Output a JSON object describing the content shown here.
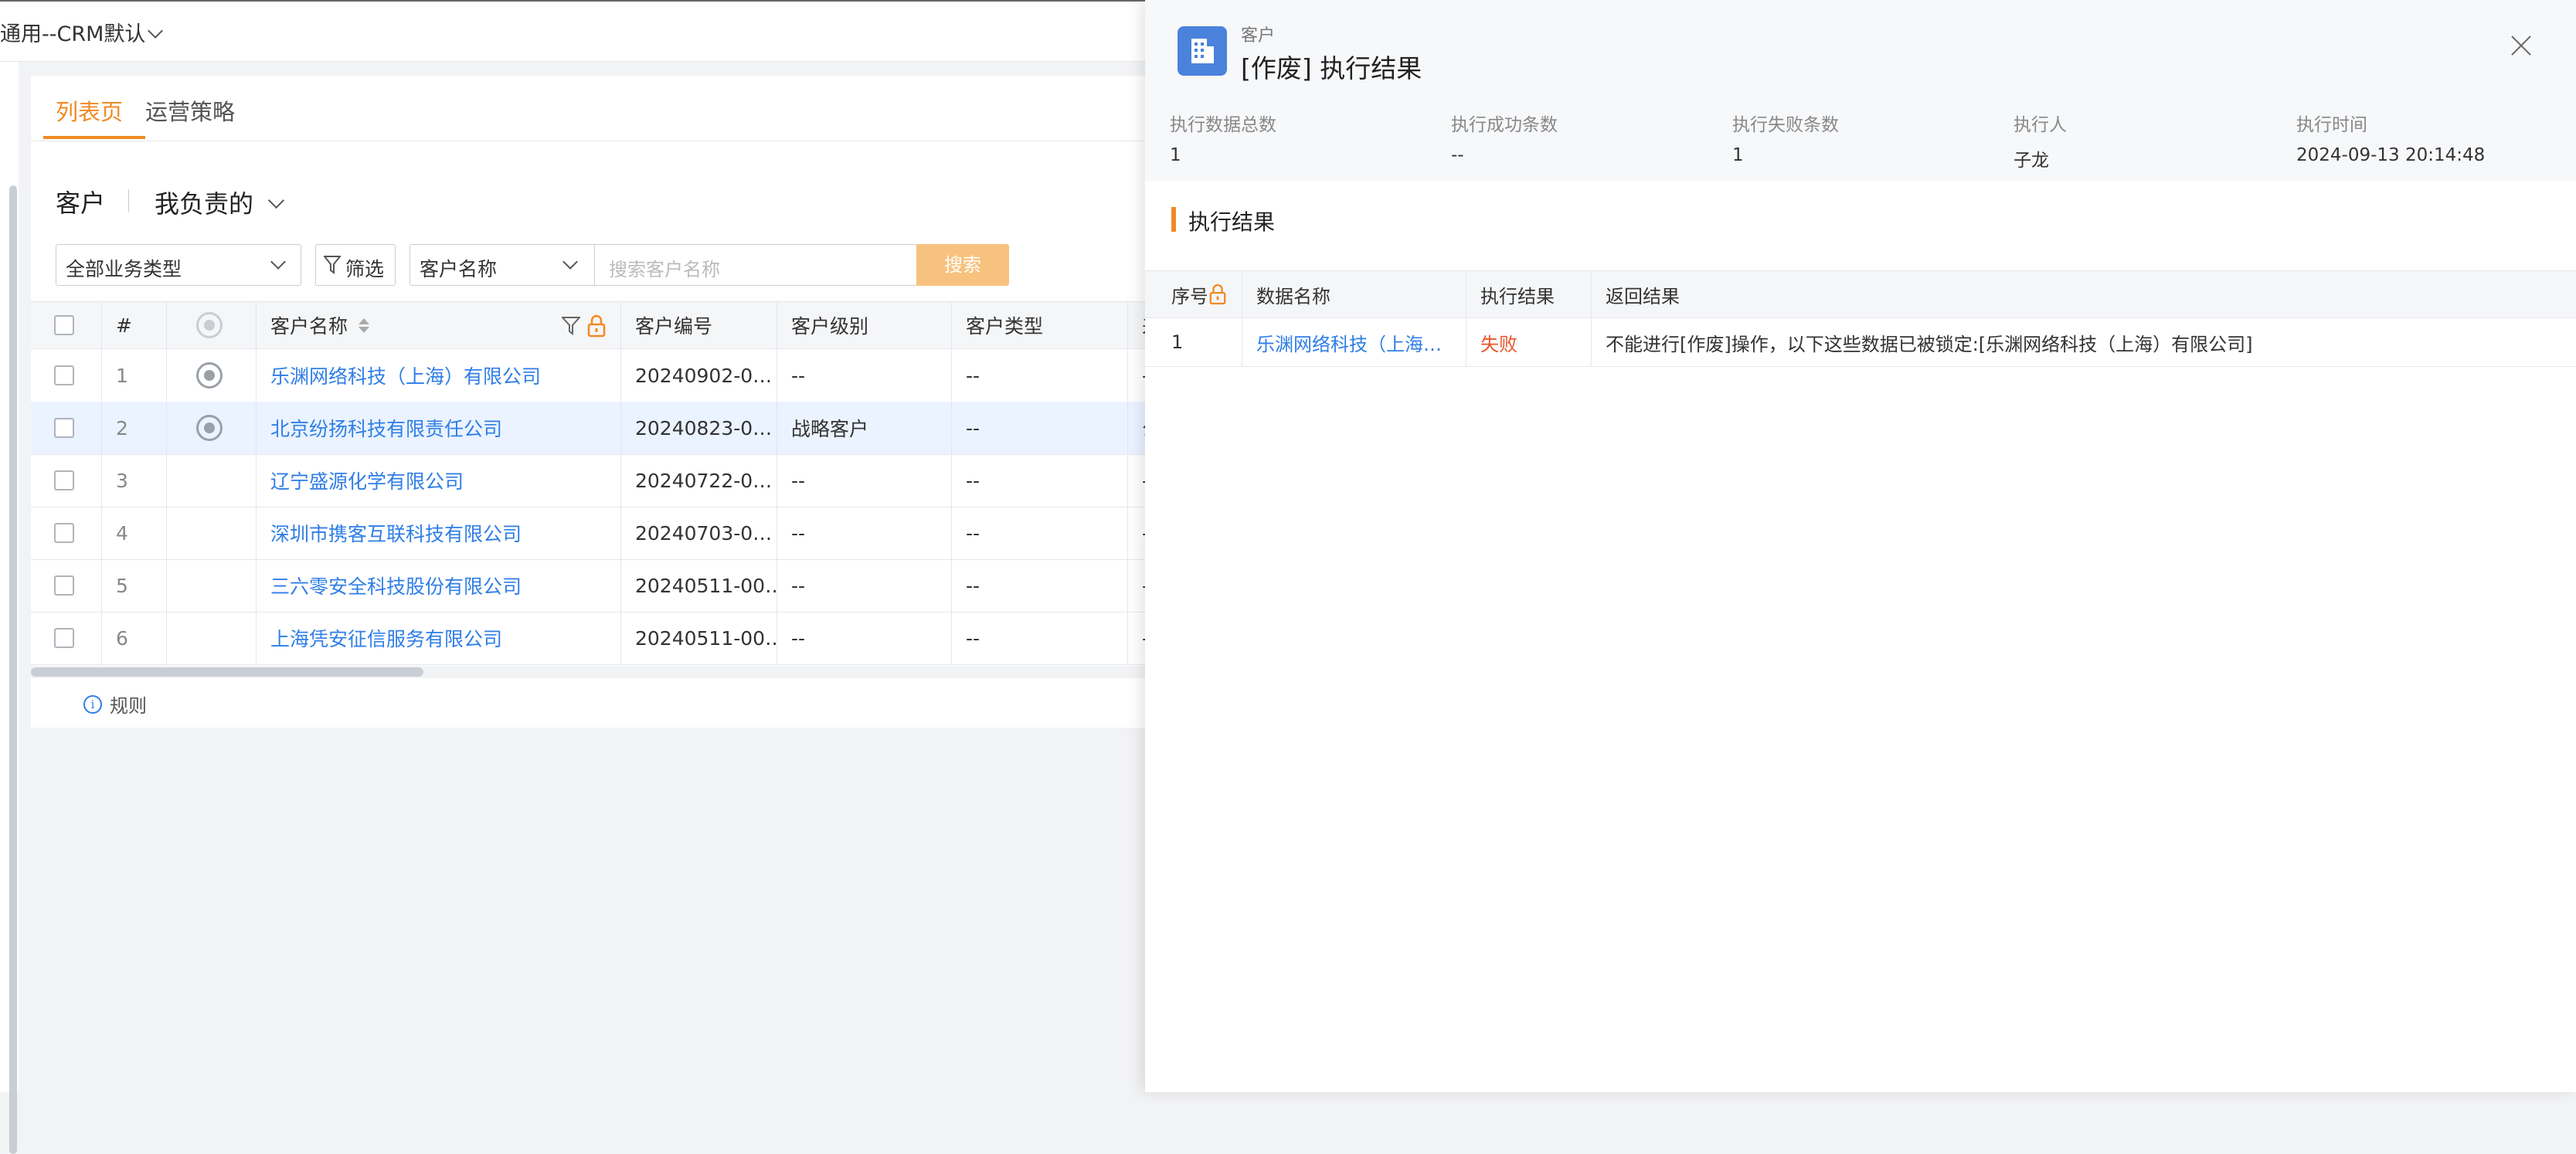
{
  "app": {
    "title": "通用--CRM默认"
  },
  "tabs": [
    {
      "label": "列表页",
      "active": true
    },
    {
      "label": "运营策略",
      "active": false
    }
  ],
  "list": {
    "title": "客户",
    "scope": "我负责的"
  },
  "filters": {
    "biz_type": "全部业务类型",
    "filter_btn": "筛选",
    "field_select": "客户名称",
    "search_placeholder": "搜索客户名称",
    "search_btn": "搜索"
  },
  "table": {
    "headers": {
      "idx": "#",
      "name": "客户名称",
      "code": "客户编号",
      "level": "客户级别",
      "type": "客户类型",
      "extra": "来"
    },
    "rows": [
      {
        "idx": "1",
        "name": "乐渊网络科技（上海）有限公司",
        "code": "20240902-0…",
        "level": "--",
        "type": "--",
        "extra": "--",
        "target": true,
        "selected": false
      },
      {
        "idx": "2",
        "name": "北京纷扬科技有限责任公司",
        "code": "20240823-0…",
        "level": "战略客户",
        "type": "--",
        "extra": "公",
        "target": true,
        "selected": true
      },
      {
        "idx": "3",
        "name": "辽宁盛源化学有限公司",
        "code": "20240722-0…",
        "level": "--",
        "type": "--",
        "extra": "--",
        "target": false,
        "selected": false
      },
      {
        "idx": "4",
        "name": "深圳市携客互联科技有限公司",
        "code": "20240703-0…",
        "level": "--",
        "type": "--",
        "extra": "--",
        "target": false,
        "selected": false
      },
      {
        "idx": "5",
        "name": "三六零安全科技股份有限公司",
        "code": "20240511-00…",
        "level": "--",
        "type": "--",
        "extra": "--",
        "target": false,
        "selected": false
      },
      {
        "idx": "6",
        "name": "上海凭安征信服务有限公司",
        "code": "20240511-00…",
        "level": "--",
        "type": "--",
        "extra": "--",
        "target": false,
        "selected": false
      }
    ]
  },
  "rules_label": "规则",
  "drawer": {
    "object_type": "客户",
    "title": "[作废] 执行结果",
    "stats": [
      {
        "label": "执行数据总数",
        "value": "1"
      },
      {
        "label": "执行成功条数",
        "value": "--"
      },
      {
        "label": "执行失败条数",
        "value": "1"
      },
      {
        "label": "执行人",
        "value": "子龙"
      },
      {
        "label": "执行时间",
        "value": "2024-09-13 20:14:48"
      }
    ],
    "section_title": "执行结果",
    "result_headers": {
      "seq": "序号",
      "name": "数据名称",
      "result": "执行结果",
      "return": "返回结果"
    },
    "results": [
      {
        "seq": "1",
        "name": "乐渊网络科技（上海…",
        "result": "失败",
        "return": "不能进行[作废]操作，以下这些数据已被锁定:[乐渊网络科技（上海）有限公司]"
      }
    ]
  },
  "colors": {
    "accent": "#f08a24",
    "link": "#2f7ee6",
    "fail": "#e8562a",
    "icon_bg": "#4a82dc",
    "search_btn": "#f7c27e"
  }
}
